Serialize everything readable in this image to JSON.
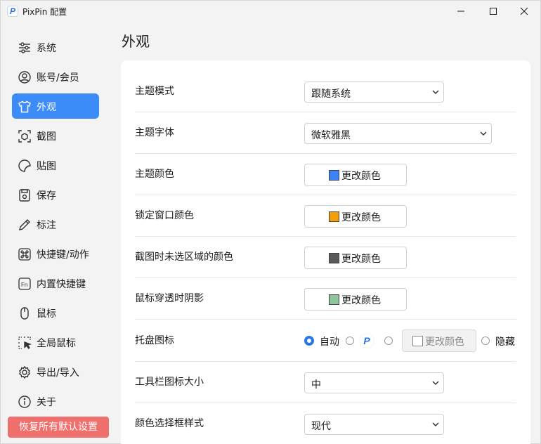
{
  "window": {
    "title": "PixPin 配置",
    "app_icon_glyph": "P",
    "controls": [
      "minimize-icon",
      "maximize-icon",
      "close-icon"
    ]
  },
  "sidebar": {
    "items": [
      {
        "label": "系统",
        "icon": "sliders-icon",
        "active": false
      },
      {
        "label": "账号/会员",
        "icon": "user-icon",
        "active": false
      },
      {
        "label": "外观",
        "icon": "shirt-icon",
        "active": true
      },
      {
        "label": "截图",
        "icon": "screenshot-icon",
        "active": false
      },
      {
        "label": "贴图",
        "icon": "sticker-icon",
        "active": false
      },
      {
        "label": "保存",
        "icon": "save-icon",
        "active": false
      },
      {
        "label": "标注",
        "icon": "pencil-icon",
        "active": false
      },
      {
        "label": "快捷键/动作",
        "icon": "command-key-icon",
        "active": false
      },
      {
        "label": "内置快捷键",
        "icon": "fn-key-icon",
        "active": false
      },
      {
        "label": "鼠标",
        "icon": "mouse-icon",
        "active": false
      },
      {
        "label": "全局鼠标",
        "icon": "cursor-select-icon",
        "active": false
      },
      {
        "label": "导出/导入",
        "icon": "gear-icon",
        "active": false
      },
      {
        "label": "关于",
        "icon": "info-icon",
        "active": false
      }
    ],
    "reset_button": "恢复所有默认设置",
    "accent": "#3b8cf8",
    "reset_color": "#ef6f6c"
  },
  "main": {
    "title": "外观",
    "settings": {
      "theme_mode": {
        "label": "主题模式",
        "value": "跟随系统"
      },
      "theme_font": {
        "label": "主题字体",
        "value": "微软雅黑"
      },
      "theme_color": {
        "label": "主题颜色",
        "button": "更改颜色",
        "swatch": "#3b82f6"
      },
      "lock_window_color": {
        "label": "锁定窗口颜色",
        "button": "更改颜色",
        "swatch": "#f59e0b"
      },
      "unselected_area_color": {
        "label": "截图时未选区域的颜色",
        "button": "更改颜色",
        "swatch": "#5a5a5a"
      },
      "mouse_passthrough_shadow": {
        "label": "鼠标穿透时阴影",
        "button": "更改颜色",
        "swatch": "#8fc59a"
      },
      "tray_icon": {
        "label": "托盘图标",
        "option_auto": "自动",
        "selected": "自动",
        "custom_color_button": "更改颜色",
        "option_hide": "隐藏"
      },
      "toolbar_icon_size": {
        "label": "工具栏图标大小",
        "value": "中"
      },
      "color_picker_style": {
        "label": "颜色选择框样式",
        "value": "现代"
      }
    }
  }
}
